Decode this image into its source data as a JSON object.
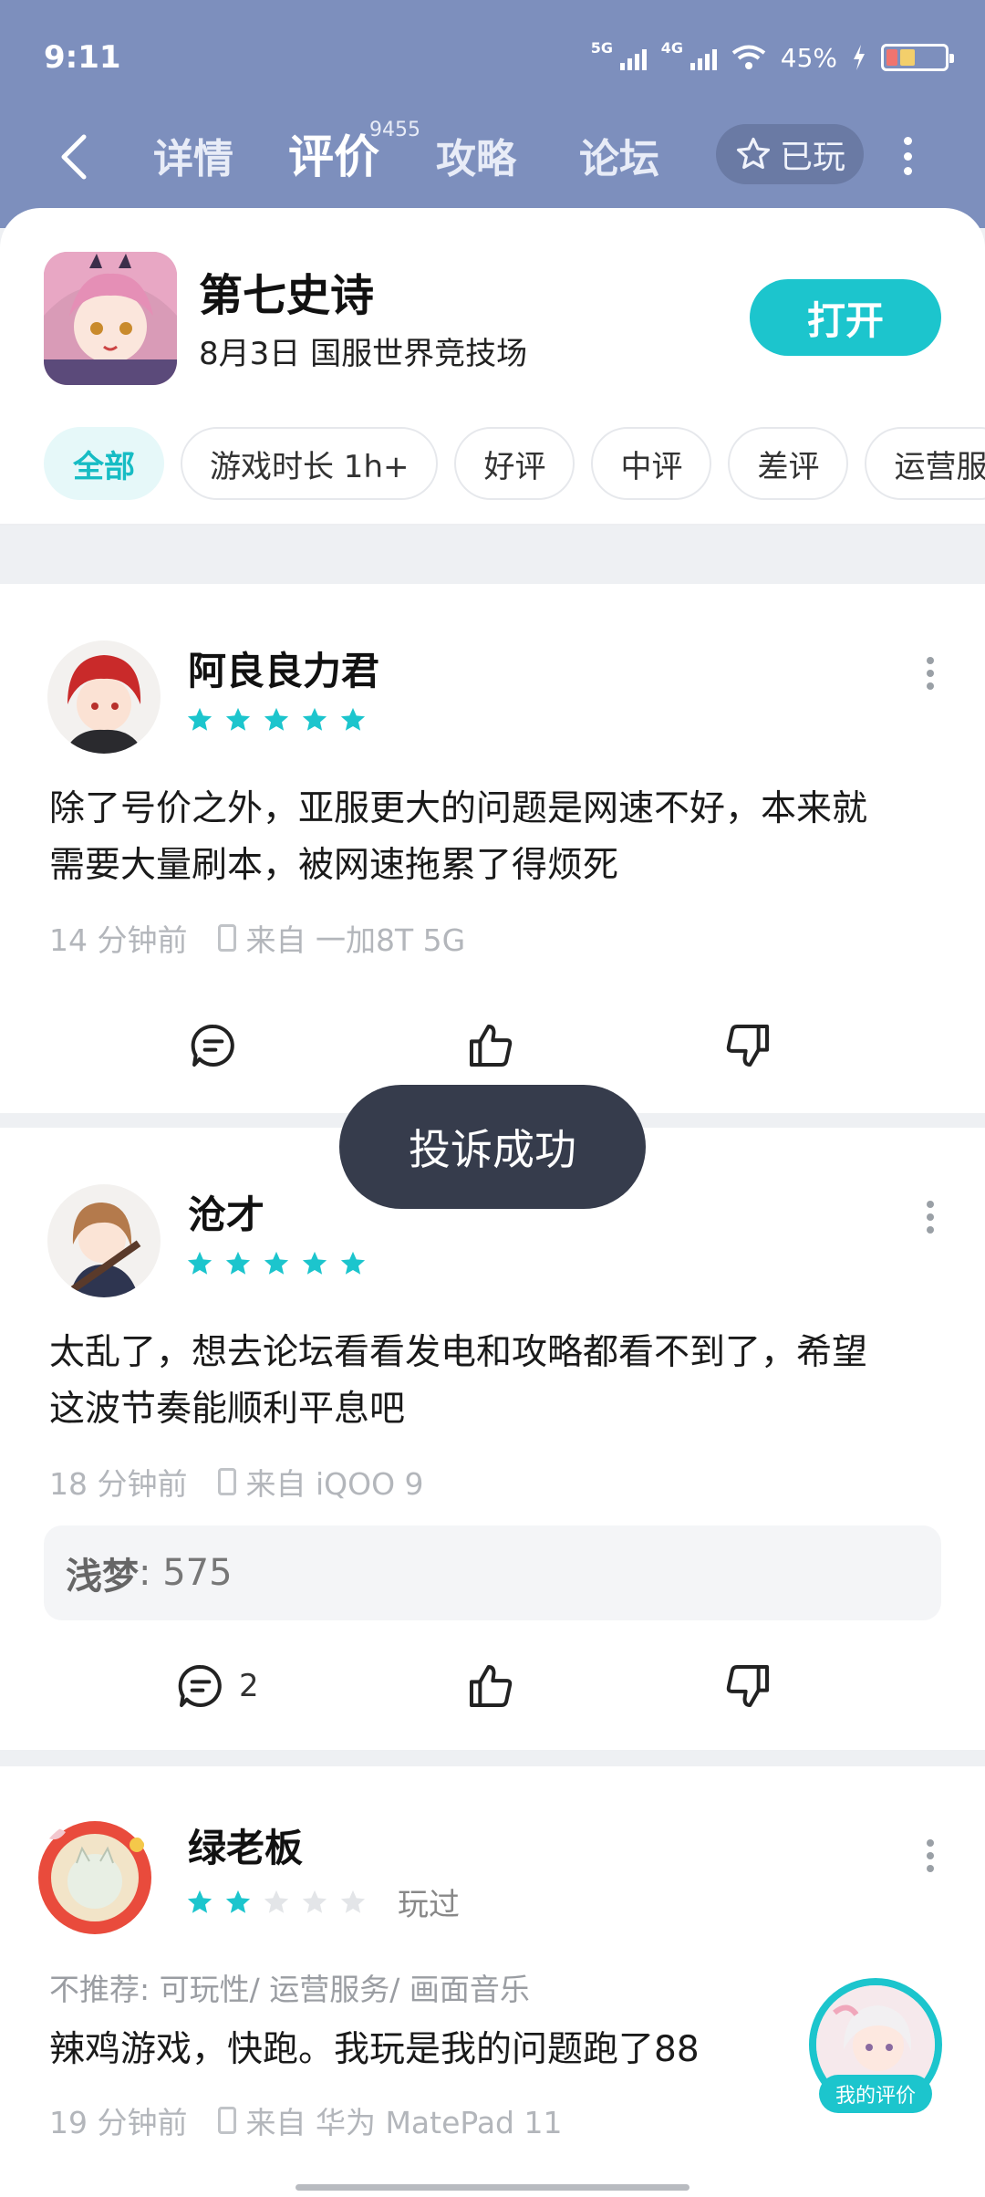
{
  "status_bar": {
    "time": "9:11",
    "net1": "5G",
    "net2": "4G",
    "battery": "45%"
  },
  "nav": {
    "tabs": [
      {
        "label": "详情"
      },
      {
        "label": "评价"
      },
      {
        "label": "攻略"
      },
      {
        "label": "论坛"
      }
    ],
    "review_count": "9455",
    "played_label": "已玩"
  },
  "game": {
    "name": "第七史诗",
    "subtitle": "8月3日 国服世界竞技场",
    "open_label": "打开"
  },
  "filters": [
    "全部",
    "游戏时长 1h+",
    "好评",
    "中评",
    "差评",
    "运营服"
  ],
  "reviews": [
    {
      "user": "阿良良力君",
      "rating": 5,
      "text_line1": "除了号价之外，亚服更大的问题是网速不好，本来就",
      "text_line2": "需要大量刷本，被网速拖累了得烦死",
      "time": "14 分钟前",
      "device": "来自 一加8T 5G"
    },
    {
      "user": "沧才",
      "rating": 5,
      "text_line1": "太乱了，想去论坛看看发电和攻略都看不到了，希望",
      "text_line2": "这波节奏能顺利平息吧",
      "time": "18 分钟前",
      "device": "来自 iQOO 9",
      "reply_user": "浅梦",
      "reply_text": ": 575",
      "comment_count": "2"
    },
    {
      "user": "绿老板",
      "rating": 2,
      "played_tag": "玩过",
      "not_recommend": "不推荐: 可玩性/ 运营服务/ 画面音乐",
      "text_line1": "辣鸡游戏，快跑。我玩是我的问题跑了88",
      "time": "19 分钟前",
      "device": "来自 华为 MatePad 11"
    }
  ],
  "toast": "投诉成功",
  "my_review_label": "我的评价",
  "colors": {
    "accent": "#1cc5cd",
    "header": "#7d8fbd",
    "toast": "#363c4c"
  }
}
